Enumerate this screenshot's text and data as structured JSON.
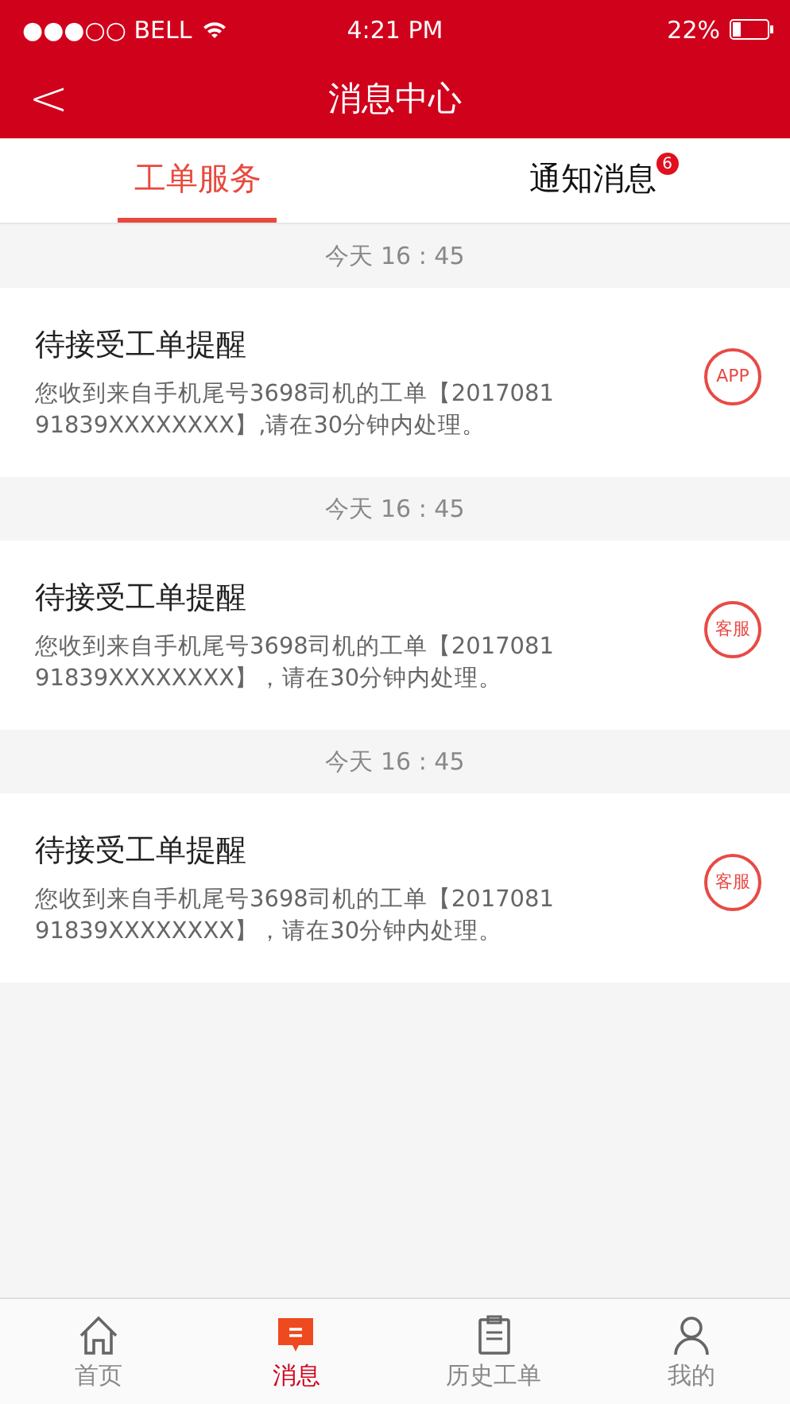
{
  "status_bar": {
    "carrier": "●●●○○ BELL",
    "time": "4:21 PM",
    "battery": "22%"
  },
  "nav": {
    "back": "<",
    "title": "消息中心"
  },
  "tabs": [
    {
      "label": "工单服务",
      "selected": true
    },
    {
      "label": "通知消息",
      "selected": false,
      "badge": "6"
    }
  ],
  "messages": [
    {
      "time": "今天  16 : 45",
      "title": "待接受工单提醒",
      "body": "您收到来自手机尾号3698司机的工单【2017081 91839XXXXXXXX】,请在30分钟内处理。",
      "source": "APP"
    },
    {
      "time": "今天  16 : 45",
      "title": "待接受工单提醒",
      "body": "您收到来自手机尾号3698司机的工单【2017081 91839XXXXXXXX】，请在30分钟内处理。",
      "source": "客服"
    },
    {
      "time": "今天  16 : 45",
      "title": "待接受工单提醒",
      "body": "您收到来自手机尾号3698司机的工单【2017081 91839XXXXXXXX】，请在30分钟内处理。",
      "source": "客服"
    }
  ],
  "tab_bar": [
    {
      "label": "首页",
      "kind": "home",
      "selected": false
    },
    {
      "label": "消息",
      "kind": "message",
      "selected": true
    },
    {
      "label": "历史工单",
      "kind": "history",
      "selected": false
    },
    {
      "label": "我的",
      "kind": "profile",
      "selected": false
    }
  ]
}
